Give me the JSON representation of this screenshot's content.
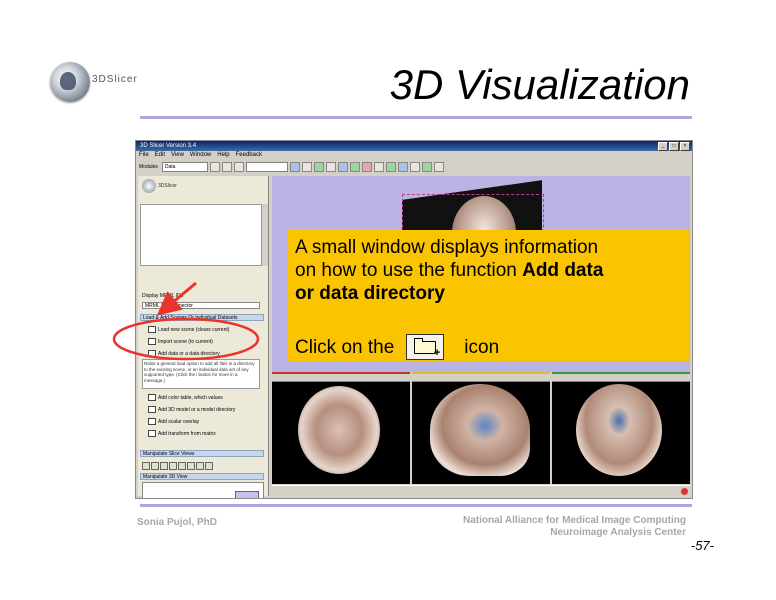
{
  "slide": {
    "title": "3D Visualization",
    "logo_text": "3DSlicer",
    "author": "Sonia Pujol, PhD",
    "affiliation_line1": "National Alliance for Medical Image Computing",
    "affiliation_line2": "Neuroimage Analysis Center",
    "page_number": "-57-"
  },
  "app": {
    "window_title": "3D Slicer Version 3.4",
    "menu": [
      "File",
      "Edit",
      "View",
      "Window",
      "Help",
      "Feedback"
    ],
    "toolbar": {
      "modules_label": "Modules",
      "module_value": "Data"
    },
    "left_panel": {
      "logo_text": "3DSlicer",
      "display_mrml_ids": "Display MRML IDs",
      "select_value": "MRML Tree Inspector",
      "section_load": "Load & Add Scenes Or Individual Datasets",
      "items": [
        "Load new scene (clears current)",
        "Import scene (to current)",
        "Add data or a data directory"
      ],
      "description": "Raise a general load option to add all files in a directory to the existing scene, or an individual data set of any supported type. (Click the i button for more in a message.)",
      "items_lower": [
        "Add color table, which values",
        "Add 3D model or a model directory",
        "Add scalar overlay",
        "Add transform from matrix"
      ],
      "section_slice": "Manipulate Slice Views",
      "section_3d": "Manipulate 3D View"
    },
    "slice_bars": [
      "",
      "",
      ""
    ]
  },
  "callout": {
    "line1": "A small window displays information",
    "line2_plain": "on how to use the function ",
    "line2_bold": "Add data",
    "line3_bold": "or data directory",
    "click_prefix": "Click on the",
    "click_suffix": "icon",
    "button_plus": "+"
  },
  "colors": {
    "callout_bg": "#fac400",
    "rule": "#a9a9e0",
    "annotation_red": "#e8342a",
    "view_bg": "#b9b4e4"
  }
}
